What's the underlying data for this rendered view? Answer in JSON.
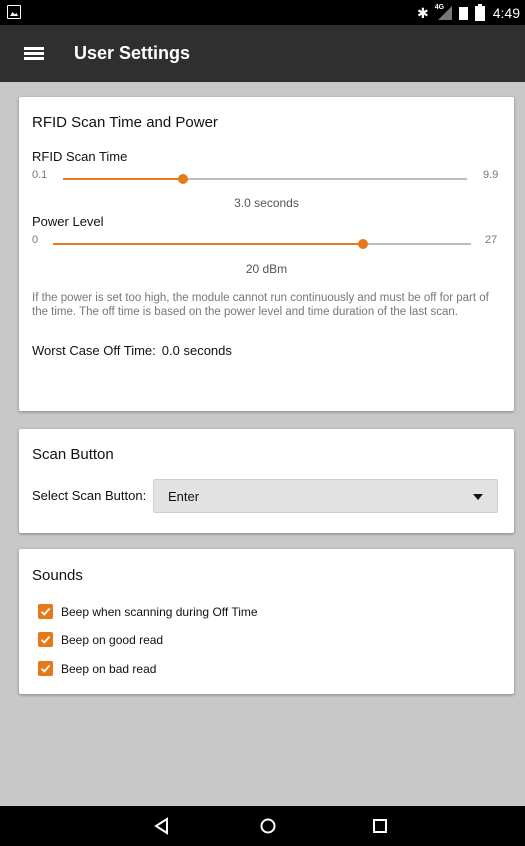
{
  "status_bar": {
    "network_label": "4G",
    "time": "4:49",
    "icons": [
      "image-icon",
      "bluetooth-icon",
      "signal-icon",
      "sim-icon",
      "battery-icon"
    ]
  },
  "app_bar": {
    "title": "User Settings",
    "menu_icon": "hamburger-menu-icon"
  },
  "rfid_card": {
    "title": "RFID Scan Time and Power",
    "scan_time": {
      "label": "RFID Scan Time",
      "min": "0.1",
      "max": "9.9",
      "min_value": 0.1,
      "max_value": 9.9,
      "current": 3.0,
      "value_text": "3.0 seconds"
    },
    "power_level": {
      "label": "Power Level",
      "min": "0",
      "max": "27",
      "min_value": 0,
      "max_value": 27,
      "current": 20,
      "value_text": "20 dBm"
    },
    "note": "If the power is set too high, the module cannot run continuously and must be off for part of the time. The off time is based on the power level and time duration of the last scan.",
    "off_time_label": "Worst Case Off Time:",
    "off_time_value": "0.0 seconds"
  },
  "scan_button_card": {
    "title": "Scan Button",
    "select_label": "Select Scan Button:",
    "selected": "Enter"
  },
  "sounds_card": {
    "title": "Sounds",
    "options": [
      {
        "label": "Beep when scanning during Off Time",
        "checked": true
      },
      {
        "label": "Beep on good read",
        "checked": true
      },
      {
        "label": "Beep on bad read",
        "checked": true
      }
    ]
  },
  "colors": {
    "accent": "#e8791a",
    "app_bar": "#2f2f2f",
    "background": "#c8c8c8"
  },
  "nav_bar": {
    "icons": [
      "back-icon",
      "home-icon",
      "recents-icon"
    ]
  }
}
